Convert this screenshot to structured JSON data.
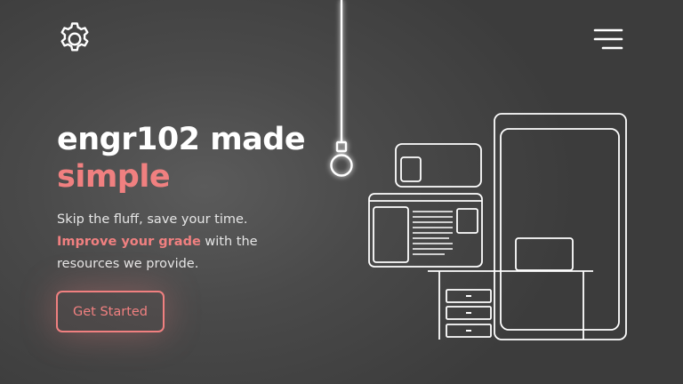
{
  "header": {
    "settings_icon": "gear-icon",
    "menu_icon": "hamburger-menu-icon"
  },
  "hero": {
    "title_line1": "engr102 made",
    "title_line2": "simple",
    "desc_line1": "Skip the fluff, save your time.",
    "desc_highlight": "Improve your grade",
    "desc_line2_rest": " with the",
    "desc_line3": "resources we provide.",
    "cta_label": "Get Started"
  },
  "colors": {
    "accent": "#f08080",
    "background": "#4a4a4a",
    "text": "#ffffff"
  },
  "illustration": {
    "icons": [
      "lightbulb-icon",
      "desk-icon",
      "tablet-icon",
      "browser-window-icon"
    ]
  }
}
